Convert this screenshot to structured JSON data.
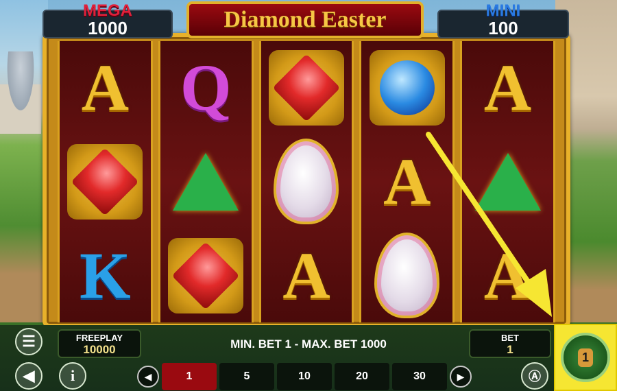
{
  "jackpots": {
    "mega": {
      "label": "MEGA",
      "value": "1000"
    },
    "mini": {
      "label": "MINI",
      "value": "100"
    }
  },
  "game_title": "Diamond Easter",
  "reels": [
    [
      "A",
      "red-gem",
      "K"
    ],
    [
      "Q",
      "green-gem",
      "red-gem"
    ],
    [
      "red-gem",
      "egg",
      "A"
    ],
    [
      "blue-gem",
      "A",
      "egg"
    ],
    [
      "A",
      "green-gem",
      "A"
    ]
  ],
  "freeplay": {
    "label": "FREEPLAY",
    "value": "10000"
  },
  "limits": "MIN. BET 1 - MAX. BET 1000",
  "bet": {
    "label": "BET",
    "value": "1"
  },
  "bet_options": [
    "1",
    "5",
    "10",
    "20",
    "30"
  ],
  "selected_bet": "1",
  "spin_badge": "1"
}
